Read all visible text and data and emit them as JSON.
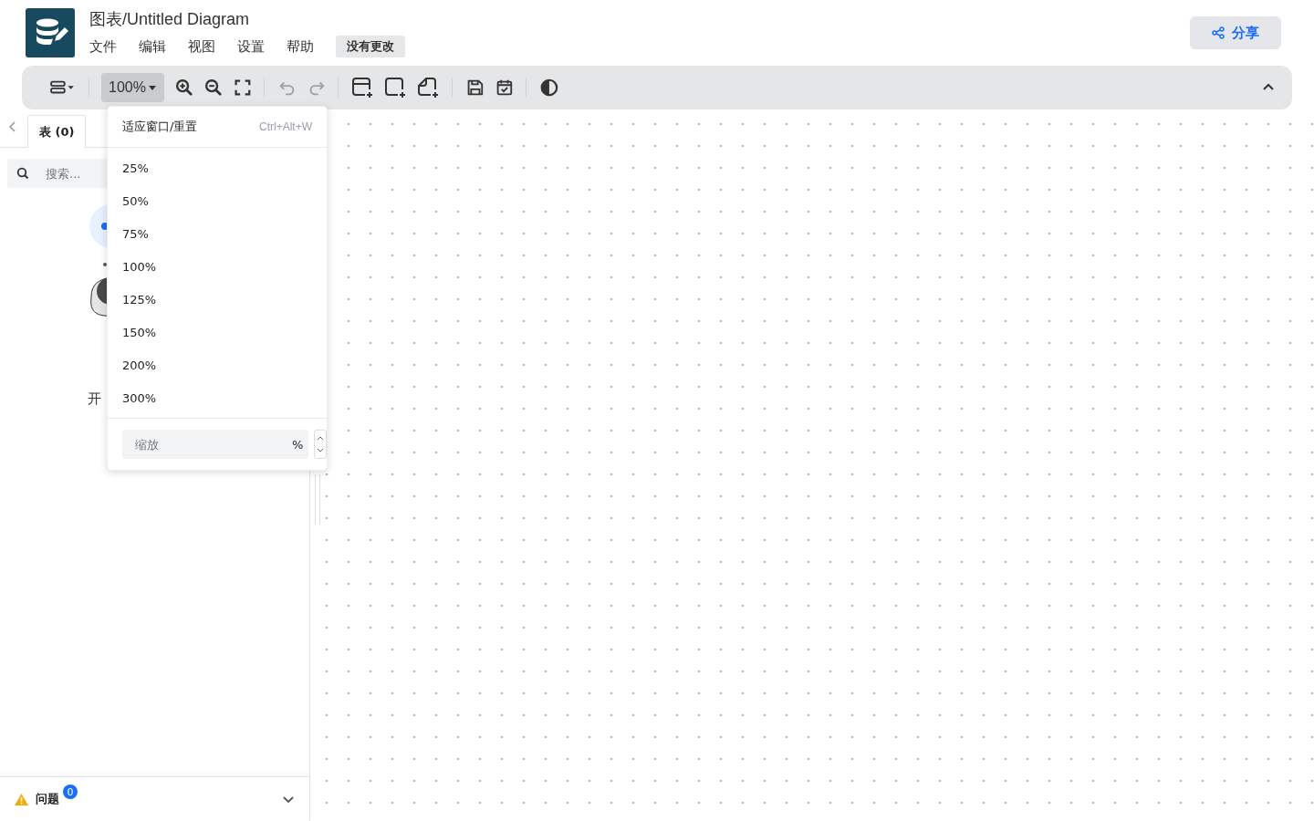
{
  "header": {
    "title": "图表/Untitled Diagram",
    "menu": [
      "文件",
      "编辑",
      "视图",
      "设置",
      "帮助"
    ],
    "status": "没有更改",
    "share": "分享"
  },
  "toolbar": {
    "tools": [
      {
        "kind": "layout",
        "disabled": false
      },
      {
        "kind": "separator"
      },
      {
        "kind": "zoom",
        "label": "100%",
        "open": true
      },
      {
        "kind": "zoom-in",
        "disabled": false
      },
      {
        "kind": "zoom-out",
        "disabled": false
      },
      {
        "kind": "fullscreen",
        "disabled": false
      },
      {
        "kind": "separator"
      },
      {
        "kind": "undo",
        "disabled": true
      },
      {
        "kind": "redo",
        "disabled": true
      },
      {
        "kind": "separator"
      },
      {
        "kind": "add-table",
        "disabled": false
      },
      {
        "kind": "add-area",
        "disabled": false
      },
      {
        "kind": "add-note",
        "disabled": false
      },
      {
        "kind": "separator"
      },
      {
        "kind": "save",
        "disabled": false
      },
      {
        "kind": "todo",
        "disabled": false
      },
      {
        "kind": "separator"
      },
      {
        "kind": "theme",
        "disabled": false
      }
    ],
    "collapsed": false
  },
  "sidebar": {
    "tabs": [
      {
        "label": "表 (0)",
        "selected": true
      }
    ],
    "search": {
      "placeholder": "搜索..."
    },
    "empty_text": "开",
    "issues": {
      "label": "问题",
      "count": "0",
      "expanded": false
    }
  },
  "zoom_menu": {
    "fit": {
      "label": "适应窗口/重置",
      "shortcut": "Ctrl+Alt+W"
    },
    "options": [
      "25%",
      "50%",
      "75%",
      "100%",
      "125%",
      "150%",
      "200%",
      "300%"
    ],
    "input": {
      "placeholder": "缩放",
      "unit": "%"
    }
  }
}
